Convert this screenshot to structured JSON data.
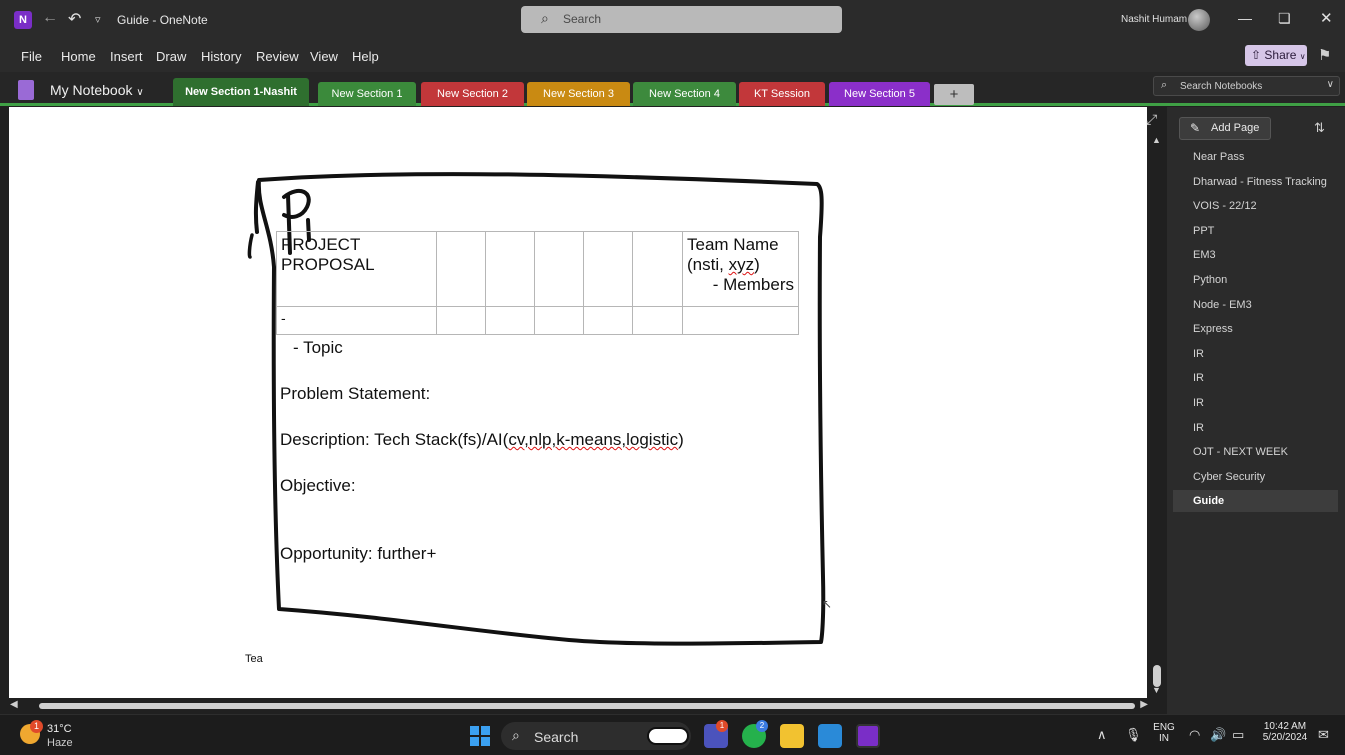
{
  "titlebar": {
    "app_icon_letter": "N",
    "doc_title": "Guide",
    "app_name": "OneNote",
    "separator": " - ",
    "search_placeholder": "Search",
    "user_name": "Nashit Humam"
  },
  "menu": {
    "items": [
      "File",
      "Home",
      "Insert",
      "Draw",
      "History",
      "Review",
      "View",
      "Help"
    ],
    "share_label": "Share"
  },
  "notebook": {
    "name": "My Notebook",
    "sections": [
      {
        "label": "New Section 1-Nashit",
        "color": "#2f6f2f",
        "active": true
      },
      {
        "label": "New Section 1",
        "color": "#3b8a3b",
        "active": false
      },
      {
        "label": "New Section 2",
        "color": "#c2373a",
        "active": false
      },
      {
        "label": "New Section 3",
        "color": "#c98a12",
        "active": false
      },
      {
        "label": "New Section 4",
        "color": "#3d8a3d",
        "active": false
      },
      {
        "label": "KT Session",
        "color": "#c2373a",
        "active": false
      },
      {
        "label": "New Section 5",
        "color": "#8b2fc9",
        "active": false
      }
    ],
    "add_tab_label": "+",
    "search_placeholder": "Search Notebooks"
  },
  "page": {
    "handwriting": "Pi",
    "table": {
      "header_left": "PROJECT PROPOSAL",
      "header_right_line1": "Team Name",
      "header_right_line2a": "(nsti, ",
      "header_right_line2b": "xyz",
      "header_right_line2c": ")",
      "header_right_line3": "- Members",
      "row2_first": "-"
    },
    "topic": "-  Topic",
    "problem": "Problem Statement:",
    "description_a": "Description: Tech Stack(fs)/AI(",
    "description_b": "cv,nlp,k-means,logistic",
    "description_c": ")",
    "objective": "Objective:",
    "opportunity": "Opportunity: further+",
    "footer_note": "Tea"
  },
  "pages_panel": {
    "add_page_label": "Add Page",
    "pages": [
      {
        "title": "Near Pass",
        "selected": false
      },
      {
        "title": "Dharwad - Fitness Tracking",
        "selected": false
      },
      {
        "title": "VOIS - 22/12",
        "selected": false
      },
      {
        "title": "PPT",
        "selected": false
      },
      {
        "title": "EM3",
        "selected": false
      },
      {
        "title": "Python",
        "selected": false
      },
      {
        "title": "Node - EM3",
        "selected": false
      },
      {
        "title": "Express",
        "selected": false
      },
      {
        "title": "IR",
        "selected": false
      },
      {
        "title": "IR",
        "selected": false
      },
      {
        "title": "IR",
        "selected": false
      },
      {
        "title": "IR",
        "selected": false
      },
      {
        "title": "OJT - NEXT WEEK",
        "selected": false
      },
      {
        "title": "Cyber Security",
        "selected": false
      },
      {
        "title": "Guide",
        "selected": true
      }
    ]
  },
  "taskbar": {
    "weather_temp": "31°C",
    "weather_desc": "Haze",
    "weather_badge": "1",
    "search_label": "Search",
    "teams_badge": "1",
    "whatsapp_badge": "2",
    "lang_line1": "ENG",
    "lang_line2": "IN",
    "time": "10:42 AM",
    "date": "5/20/2024"
  }
}
